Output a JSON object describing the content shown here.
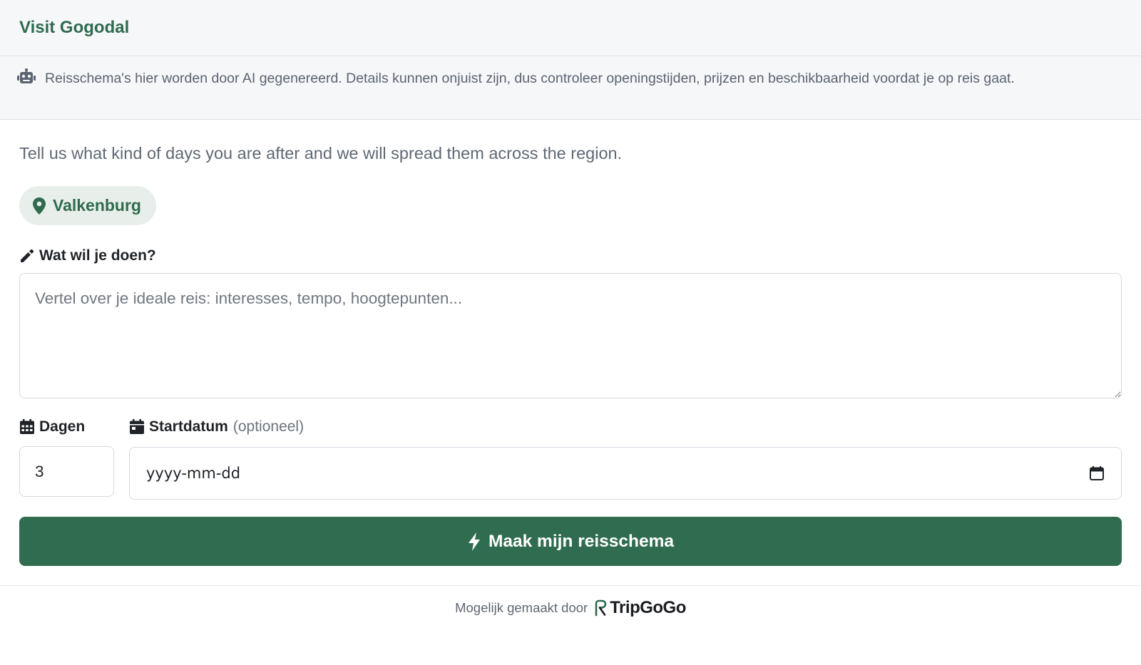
{
  "header": {
    "title": "Visit Gogodal"
  },
  "notice": {
    "icon": "robot-icon",
    "text": "Reisschema's hier worden door AI gegenereerd. Details kunnen onjuist zijn, dus controleer openingstijden, prijzen en beschikbaarheid voordat je op reis gaat."
  },
  "intro": "Tell us what kind of days you are after and we will spread them across the region.",
  "location": {
    "icon": "map-pin-icon",
    "label": "Valkenburg"
  },
  "activity": {
    "icon": "pencil-icon",
    "label": "Wat wil je doen?",
    "value": "",
    "placeholder": "Vertel over je ideale reis: interesses, tempo, hoogtepunten..."
  },
  "days": {
    "icon": "calendar-grid-icon",
    "label": "Dagen",
    "value": "3"
  },
  "start_date": {
    "icon": "calendar-icon",
    "label": "Startdatum",
    "optional_label": "(optioneel)",
    "placeholder": "yyyy-mm-dd",
    "picker_icon": "calendar-picker-icon"
  },
  "submit": {
    "icon": "bolt-icon",
    "label": "Maak mijn reisschema"
  },
  "footer": {
    "text": "Mogelijk gemaakt door",
    "brand": "TripGoGo"
  },
  "colors": {
    "brand_green": "#306c4f",
    "header_green": "#2f6b4f"
  }
}
